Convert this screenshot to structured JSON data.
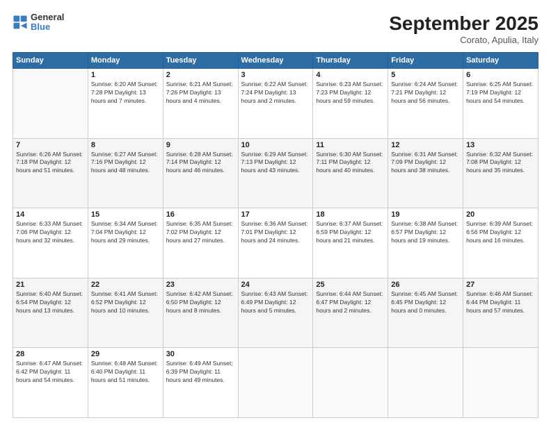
{
  "header": {
    "logo_general": "General",
    "logo_blue": "Blue",
    "month_title": "September 2025",
    "location": "Corato, Apulia, Italy"
  },
  "days_of_week": [
    "Sunday",
    "Monday",
    "Tuesday",
    "Wednesday",
    "Thursday",
    "Friday",
    "Saturday"
  ],
  "weeks": [
    [
      {
        "day": "",
        "info": ""
      },
      {
        "day": "1",
        "info": "Sunrise: 6:20 AM\nSunset: 7:28 PM\nDaylight: 13 hours\nand 7 minutes."
      },
      {
        "day": "2",
        "info": "Sunrise: 6:21 AM\nSunset: 7:26 PM\nDaylight: 13 hours\nand 4 minutes."
      },
      {
        "day": "3",
        "info": "Sunrise: 6:22 AM\nSunset: 7:24 PM\nDaylight: 13 hours\nand 2 minutes."
      },
      {
        "day": "4",
        "info": "Sunrise: 6:23 AM\nSunset: 7:23 PM\nDaylight: 12 hours\nand 59 minutes."
      },
      {
        "day": "5",
        "info": "Sunrise: 6:24 AM\nSunset: 7:21 PM\nDaylight: 12 hours\nand 56 minutes."
      },
      {
        "day": "6",
        "info": "Sunrise: 6:25 AM\nSunset: 7:19 PM\nDaylight: 12 hours\nand 54 minutes."
      }
    ],
    [
      {
        "day": "7",
        "info": "Sunrise: 6:26 AM\nSunset: 7:18 PM\nDaylight: 12 hours\nand 51 minutes."
      },
      {
        "day": "8",
        "info": "Sunrise: 6:27 AM\nSunset: 7:16 PM\nDaylight: 12 hours\nand 48 minutes."
      },
      {
        "day": "9",
        "info": "Sunrise: 6:28 AM\nSunset: 7:14 PM\nDaylight: 12 hours\nand 46 minutes."
      },
      {
        "day": "10",
        "info": "Sunrise: 6:29 AM\nSunset: 7:13 PM\nDaylight: 12 hours\nand 43 minutes."
      },
      {
        "day": "11",
        "info": "Sunrise: 6:30 AM\nSunset: 7:11 PM\nDaylight: 12 hours\nand 40 minutes."
      },
      {
        "day": "12",
        "info": "Sunrise: 6:31 AM\nSunset: 7:09 PM\nDaylight: 12 hours\nand 38 minutes."
      },
      {
        "day": "13",
        "info": "Sunrise: 6:32 AM\nSunset: 7:08 PM\nDaylight: 12 hours\nand 35 minutes."
      }
    ],
    [
      {
        "day": "14",
        "info": "Sunrise: 6:33 AM\nSunset: 7:06 PM\nDaylight: 12 hours\nand 32 minutes."
      },
      {
        "day": "15",
        "info": "Sunrise: 6:34 AM\nSunset: 7:04 PM\nDaylight: 12 hours\nand 29 minutes."
      },
      {
        "day": "16",
        "info": "Sunrise: 6:35 AM\nSunset: 7:02 PM\nDaylight: 12 hours\nand 27 minutes."
      },
      {
        "day": "17",
        "info": "Sunrise: 6:36 AM\nSunset: 7:01 PM\nDaylight: 12 hours\nand 24 minutes."
      },
      {
        "day": "18",
        "info": "Sunrise: 6:37 AM\nSunset: 6:59 PM\nDaylight: 12 hours\nand 21 minutes."
      },
      {
        "day": "19",
        "info": "Sunrise: 6:38 AM\nSunset: 6:57 PM\nDaylight: 12 hours\nand 19 minutes."
      },
      {
        "day": "20",
        "info": "Sunrise: 6:39 AM\nSunset: 6:56 PM\nDaylight: 12 hours\nand 16 minutes."
      }
    ],
    [
      {
        "day": "21",
        "info": "Sunrise: 6:40 AM\nSunset: 6:54 PM\nDaylight: 12 hours\nand 13 minutes."
      },
      {
        "day": "22",
        "info": "Sunrise: 6:41 AM\nSunset: 6:52 PM\nDaylight: 12 hours\nand 10 minutes."
      },
      {
        "day": "23",
        "info": "Sunrise: 6:42 AM\nSunset: 6:50 PM\nDaylight: 12 hours\nand 8 minutes."
      },
      {
        "day": "24",
        "info": "Sunrise: 6:43 AM\nSunset: 6:49 PM\nDaylight: 12 hours\nand 5 minutes."
      },
      {
        "day": "25",
        "info": "Sunrise: 6:44 AM\nSunset: 6:47 PM\nDaylight: 12 hours\nand 2 minutes."
      },
      {
        "day": "26",
        "info": "Sunrise: 6:45 AM\nSunset: 6:45 PM\nDaylight: 12 hours\nand 0 minutes."
      },
      {
        "day": "27",
        "info": "Sunrise: 6:46 AM\nSunset: 6:44 PM\nDaylight: 11 hours\nand 57 minutes."
      }
    ],
    [
      {
        "day": "28",
        "info": "Sunrise: 6:47 AM\nSunset: 6:42 PM\nDaylight: 11 hours\nand 54 minutes."
      },
      {
        "day": "29",
        "info": "Sunrise: 6:48 AM\nSunset: 6:40 PM\nDaylight: 11 hours\nand 51 minutes."
      },
      {
        "day": "30",
        "info": "Sunrise: 6:49 AM\nSunset: 6:39 PM\nDaylight: 11 hours\nand 49 minutes."
      },
      {
        "day": "",
        "info": ""
      },
      {
        "day": "",
        "info": ""
      },
      {
        "day": "",
        "info": ""
      },
      {
        "day": "",
        "info": ""
      }
    ]
  ]
}
